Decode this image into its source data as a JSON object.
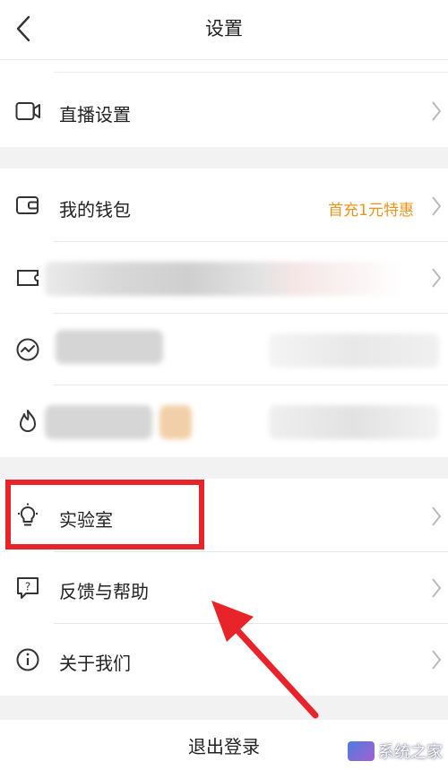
{
  "header": {
    "title": "设置",
    "back_icon": "chevron-left-icon"
  },
  "rows": {
    "live": {
      "label": "直播设置",
      "icon": "video-camera-icon"
    },
    "wallet": {
      "label": "我的钱包",
      "value": "首充1元特惠",
      "icon": "wallet-icon"
    },
    "blurred_1": {
      "icon": "ticket-icon"
    },
    "blurred_2": {
      "icon": "activity-icon"
    },
    "blurred_3": {
      "icon": "flame-icon"
    },
    "lab": {
      "label": "实验室",
      "icon": "lightbulb-icon"
    },
    "feedback": {
      "label": "反馈与帮助",
      "icon": "question-bubble-icon"
    },
    "about": {
      "label": "关于我们",
      "icon": "info-circle-icon"
    }
  },
  "logout": {
    "label": "退出登录"
  },
  "watermark": {
    "text": "系统之家"
  },
  "colors": {
    "accent": "#e8951e",
    "highlight": "#e8232a",
    "background_gap": "#f2f2f2"
  }
}
